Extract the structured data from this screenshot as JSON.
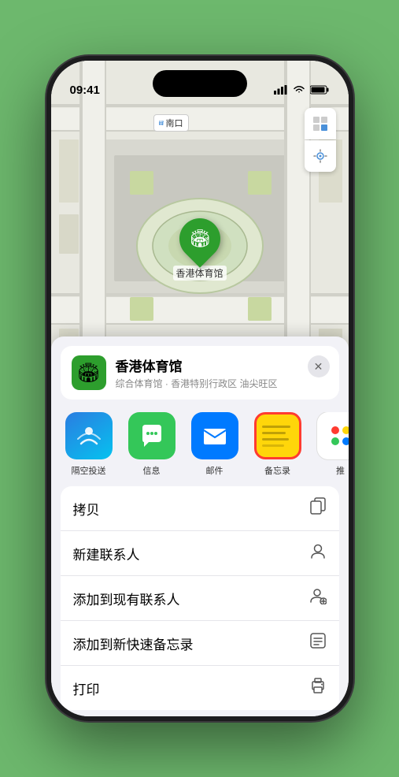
{
  "status_bar": {
    "time": "09:41",
    "location_arrow": "▶",
    "signal": "●●●",
    "wifi": "wifi",
    "battery": "🔋"
  },
  "map": {
    "south_entrance_label": "南口",
    "map_icon": "🗺",
    "location_icon": "↗"
  },
  "location_card": {
    "name": "香港体育馆",
    "description": "综合体育馆 · 香港特别行政区 油尖旺区",
    "icon": "🏟",
    "close": "✕"
  },
  "share_apps": [
    {
      "id": "airdrop",
      "label": "隔空投送",
      "type": "airdrop"
    },
    {
      "id": "messages",
      "label": "信息",
      "type": "messages"
    },
    {
      "id": "mail",
      "label": "邮件",
      "type": "mail"
    },
    {
      "id": "notes",
      "label": "备忘录",
      "type": "notes"
    },
    {
      "id": "more",
      "label": "推",
      "type": "more"
    }
  ],
  "actions": [
    {
      "id": "copy",
      "label": "拷贝",
      "icon": "⿴"
    },
    {
      "id": "new-contact",
      "label": "新建联系人",
      "icon": "👤"
    },
    {
      "id": "add-contact",
      "label": "添加到现有联系人",
      "icon": "👤"
    },
    {
      "id": "quick-note",
      "label": "添加到新快速备忘录",
      "icon": "⬜"
    },
    {
      "id": "print",
      "label": "打印",
      "icon": "🖨"
    }
  ],
  "marker": {
    "label": "香港体育馆",
    "icon": "🏟"
  }
}
